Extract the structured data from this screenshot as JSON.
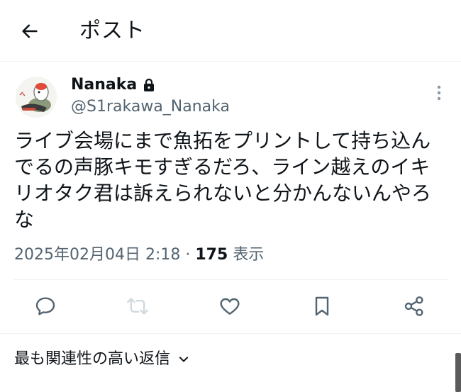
{
  "header": {
    "title": "ポスト",
    "back_icon": "arrow-left-icon"
  },
  "post": {
    "author": {
      "display_name": "Nanaka",
      "handle": "@S1rakawa_Nanaka",
      "protected_icon": "lock-icon",
      "avatar": "avatar-illustration"
    },
    "text": "ライブ会場にまで魚拓をプリントして持ち込んでるの声豚キモすぎるだろ、ライン越えのイキリオタク君は訴えられないと分かんないんやろな",
    "timestamp": "2025年02月04日 2:18",
    "separator": "·",
    "views_count": "175",
    "views_label": "表示"
  },
  "actions": {
    "reply_icon": "reply-icon",
    "repost_icon": "repost-icon",
    "like_icon": "heart-icon",
    "bookmark_icon": "bookmark-icon",
    "share_icon": "share-icon"
  },
  "replies": {
    "sort_label": "最も関連性の高い返信"
  },
  "colors": {
    "text": "#0f1419",
    "secondary": "#536471",
    "disabled": "#cfd9de",
    "divider": "#eff3f4"
  }
}
